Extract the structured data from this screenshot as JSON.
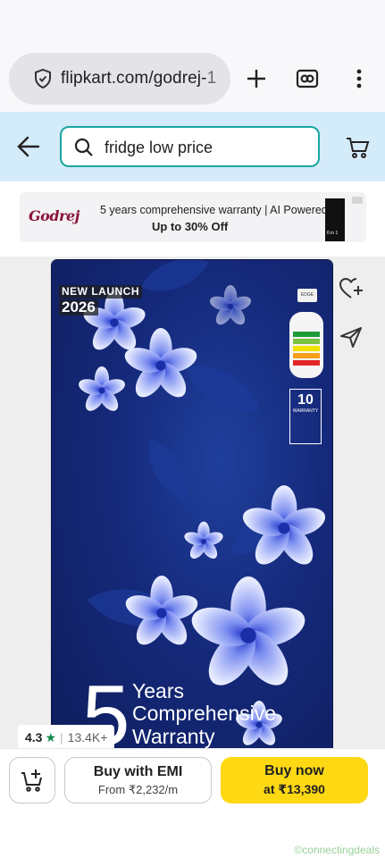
{
  "browser": {
    "url_main": "flipkart.com/godrej-",
    "url_faded": "1",
    "new_tab_icon": "plus-icon",
    "tab_switcher_icon": "tab-switcher-icon",
    "menu_icon": "vertical-dots-icon"
  },
  "header": {
    "back_icon": "arrow-left-icon",
    "search_query": "fridge low price",
    "cart_icon": "cart-icon",
    "background": "#d4ebf9",
    "search_border": "#1aa5a0"
  },
  "ad": {
    "brand": "Godrej",
    "line1": "5 years comprehensive warranty | AI Powered",
    "line2": "Up to 30% Off",
    "image_label": "6 in 1"
  },
  "product": {
    "launch_line1": "NEW LAUNCH",
    "launch_line2": "2026",
    "brand_tag": "EDGE",
    "warranty_badge_num": "10",
    "warranty_badge_text": "WARRANTY",
    "big_number": "5",
    "promo_line1": "Years",
    "promo_line2": "Comprehensive",
    "promo_line3": "Warranty",
    "wishlist_icon": "heart-plus-icon",
    "share_icon": "share-icon",
    "rating": "4.3",
    "rating_star": "★",
    "rating_count": "13.4K+"
  },
  "actions": {
    "add_to_cart_icon": "cart-add-icon",
    "emi_label": "Buy with EMI",
    "emi_sub": "From ₹2,232/m",
    "buy_label": "Buy now",
    "buy_sub": "at ₹13,390",
    "buy_color": "#ffd814"
  },
  "watermark": "©connectingdeals"
}
